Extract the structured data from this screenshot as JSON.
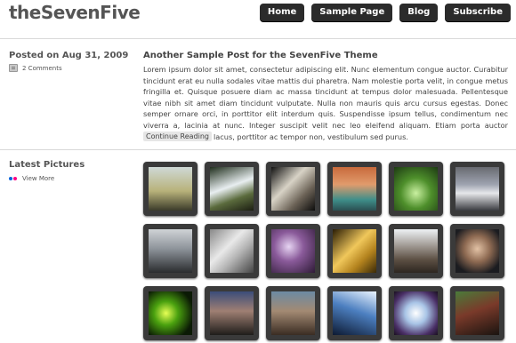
{
  "header": {
    "logo": "theSevenFive",
    "nav": [
      "Home",
      "Sample Page",
      "Blog",
      "Subscribe"
    ]
  },
  "post": {
    "date": "Posted on Aug 31, 2009",
    "comments": "2 Comments",
    "title": "Another Sample Post for the SevenFive Theme",
    "body": "Lorem ipsum dolor sit amet, consectetur adipiscing elit. Nunc elementum congue auctor. Curabitur tincidunt erat eu nulla sodales vitae mattis dui pharetra. Nam molestie porta velit, in congue metus fringilla et. Quisque posuere diam ac massa tincidunt at tempus dolor malesuada. Pellentesque vitae nibh sit amet diam tincidunt vulputate. Nulla non mauris quis arcu cursus egestas. Donec semper ornare orci, in porttitor elit interdum quis. Suspendisse ipsum tellus, condimentum nec viverra a, lacinia at nunc. Integer suscipit velit nec leo eleifend aliquam. Etiam porta auctor sagittis. Donec elit lacus, porttitor ac tempor non, vestibulum sed purus.",
    "continue_label": "Continue Reading"
  },
  "pictures": {
    "title": "Latest Pictures",
    "view_more": "View More",
    "icon": "flickr-icon",
    "flickr_colors": [
      "#0063dc",
      "#ff0084"
    ],
    "thumbs": [
      "linear-gradient(180deg,#cfd9d6 0%,#b8b27a 55%,#3b3b2a 100%)",
      "linear-gradient(160deg,#1f2e1c 0%,#e8eef0 45%,#5b6b3d 70%,#1c1e12 100%)",
      "linear-gradient(135deg,#111 0%,#d8d3c6 40%,#6b6256 70%,#0c0c0c 100%)",
      "linear-gradient(180deg,#c86a3c 0%,#e19b6c 40%,#3f8f8a 75%,#2b4f52 100%)",
      "radial-gradient(circle at 50% 60%,#c9f0a0 0%,#4e8f2b 45%,#1d3a13 100%)",
      "linear-gradient(180deg,#686a70 0%,#9ea3b0 40%,#e6e7ea 60%,#3a3b40 100%)",
      "linear-gradient(180deg,#cfd3d6 0%,#8d939a 45%,#2a2c2e 100%)",
      "linear-gradient(135deg,#888 0%,#e9e9e9 40%,#b8b8b8 60%,#444 100%)",
      "radial-gradient(circle at 40% 40%,#e6d4f2 0%,#8a5a9a 40%,#2e1b36 100%)",
      "linear-gradient(135deg,#2a1d05 0%,#f0c75b 45%,#b4831e 70%,#3a2a08 100%)",
      "linear-gradient(180deg,#eef2f5 0%,#9c958e 40%,#5c4f43 70%,#2d2620 100%)",
      "radial-gradient(circle at 50% 45%,#e2c2a5 0%,#8e6a52 40%,#1b1c20 80%)",
      "radial-gradient(circle at 40% 50%,#e7ff55 0%,#4aa10f 35%,#0b1a05 80%)",
      "linear-gradient(180deg,#3b4d7a 0%,#9f7f73 45%,#1f1d1a 100%)",
      "linear-gradient(180deg,#6c8aa3 0%,#a38a73 45%,#3a2c22 100%)",
      "linear-gradient(200deg,#eaf4ff 0%,#4c7fc0 45%,#0d1a33 100%)",
      "radial-gradient(circle at 50% 50%,#ffffff 0%,#a8c4e6 35%,#4a2f66 75%,#1a1020 100%)",
      "linear-gradient(160deg,#4a7b3a 0%,#7a3a2a 45%,#1a1410 100%)"
    ]
  }
}
